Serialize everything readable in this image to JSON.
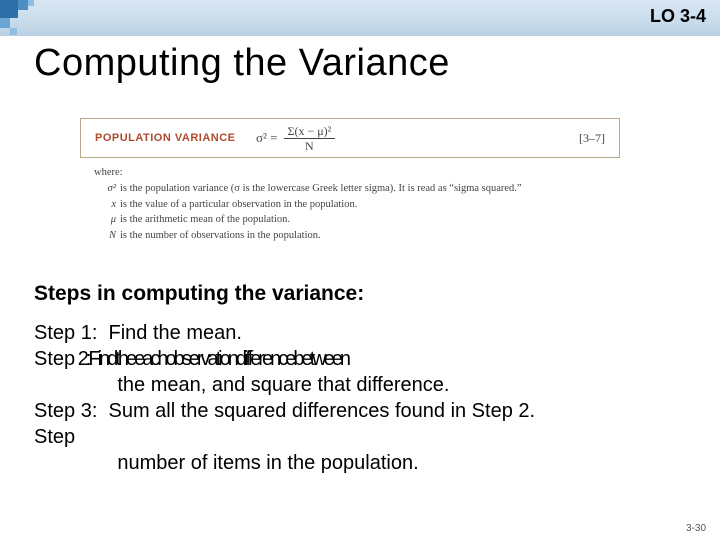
{
  "lo_label": "LO 3-4",
  "title": "Computing the Variance",
  "formula": {
    "label": "POPULATION VARIANCE",
    "lhs": "σ² =",
    "numerator": "Σ(x − μ)²",
    "denominator": "N",
    "ref": "[3–7]"
  },
  "where_label": "where:",
  "where": [
    {
      "sym": "σ²",
      "txt": "is the population variance (σ is the lowercase Greek letter sigma). It is read as “sigma squared.”"
    },
    {
      "sym": "x",
      "txt": "is the value of a particular observation in the population."
    },
    {
      "sym": "μ",
      "txt": "is the arithmetic mean of the population."
    },
    {
      "sym": "N",
      "txt": "is the number of observations in the population."
    }
  ],
  "steps_header": "Steps in computing the variance:",
  "steps_lines": [
    "Step 1:  Find the mean.",
    "Step 2:Findtheeachobservationdifferencebetween",
    "               the mean, and square that difference.",
    "Step 3:  Sum all the squared differences found in Step 2.",
    "Step",
    "               number of items in the population."
  ],
  "footer": "3-30"
}
